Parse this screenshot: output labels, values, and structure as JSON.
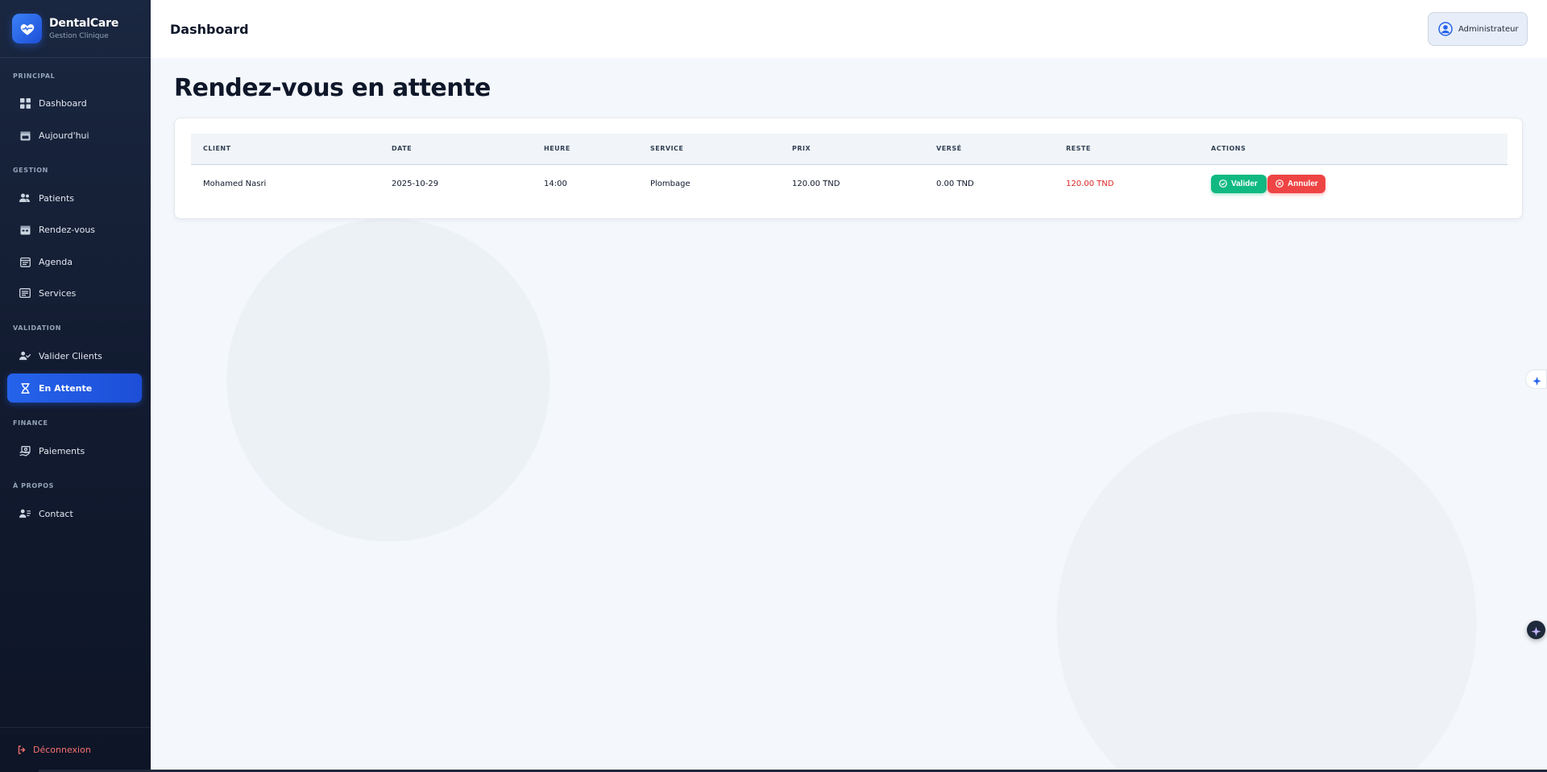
{
  "brand": {
    "title": "DentalCare",
    "subtitle": "Gestion Clinique"
  },
  "sidebar": {
    "sections": [
      "PRINCIPAL",
      "GESTION",
      "VALIDATION",
      "FINANCE",
      "À PROPOS"
    ],
    "items": [
      {
        "label": "Dashboard",
        "icon": "grid-icon"
      },
      {
        "label": "Aujourd'hui",
        "icon": "calendar-icon"
      },
      {
        "label": "Patients",
        "icon": "users-icon"
      },
      {
        "label": "Rendez-vous",
        "icon": "calendar-check-icon"
      },
      {
        "label": "Agenda",
        "icon": "agenda-icon"
      },
      {
        "label": "Services",
        "icon": "list-icon"
      },
      {
        "label": "Valider Clients",
        "icon": "user-check-icon"
      },
      {
        "label": "En Attente",
        "icon": "hourglass-icon",
        "active": true
      },
      {
        "label": "Paiements",
        "icon": "payment-icon"
      },
      {
        "label": "Contact",
        "icon": "contact-icon"
      }
    ],
    "logout": "Déconnexion"
  },
  "header": {
    "title": "Dashboard",
    "user": "Administrateur"
  },
  "page": {
    "title": "Rendez-vous en attente"
  },
  "table": {
    "columns": [
      "CLIENT",
      "DATE",
      "HEURE",
      "SERVICE",
      "PRIX",
      "VERSÉ",
      "RESTE",
      "ACTIONS"
    ],
    "rows": [
      {
        "client": "Mohamed Nasri",
        "date": "2025-10-29",
        "heure": "14:00",
        "service": "Plombage",
        "prix": "120.00 TND",
        "verse": "0.00 TND",
        "reste": "120.00 TND"
      }
    ],
    "actions": {
      "validate": "Valider",
      "cancel": "Annuler"
    }
  },
  "colors": {
    "primary": "#2563eb",
    "success": "#10b981",
    "danger": "#ef4444",
    "sidebar": "#121b30"
  }
}
